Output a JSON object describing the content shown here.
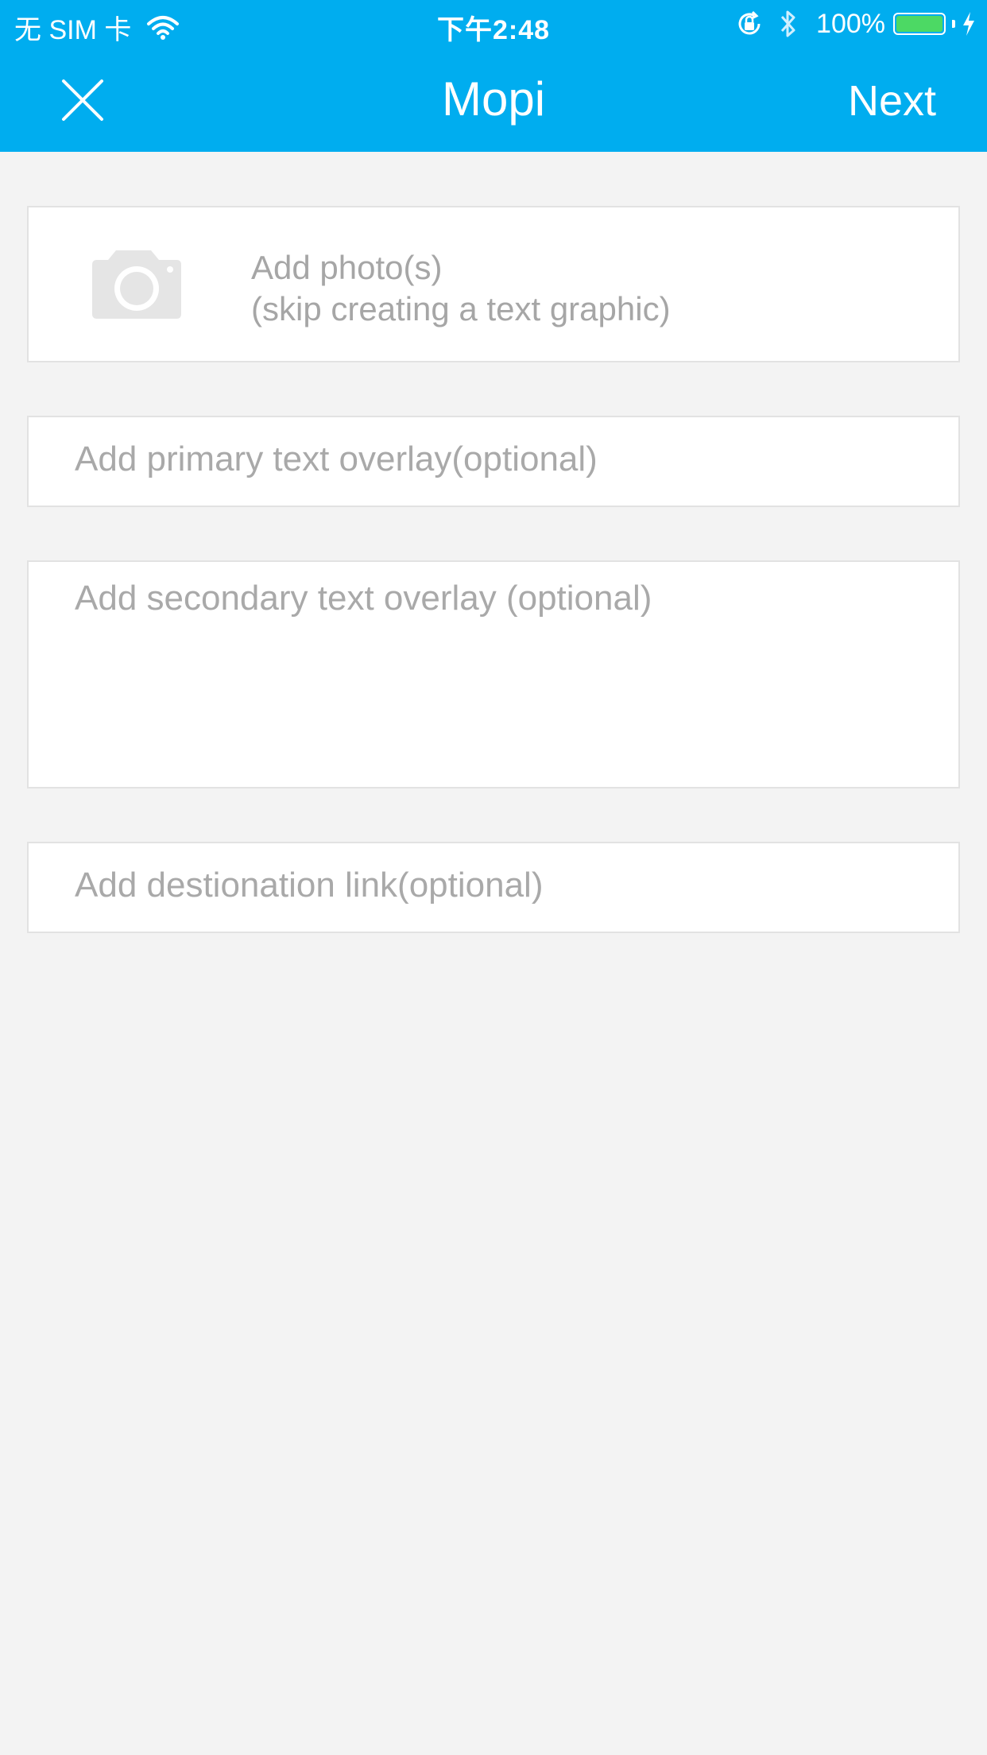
{
  "status_bar": {
    "carrier": "无 SIM 卡",
    "time": "下午2:48",
    "battery_percent": "100%",
    "battery_level": 1.0,
    "battery_color": "#4cd964",
    "icons": [
      "wifi-icon",
      "rotation-lock-icon",
      "bluetooth-icon",
      "battery-icon",
      "charging-icon"
    ]
  },
  "nav": {
    "title": "Mopi",
    "close_icon": "close-icon",
    "next_label": "Next",
    "background": "#00adef"
  },
  "photo_picker": {
    "icon": "camera-icon",
    "line1": "Add photo(s)",
    "line2": "(skip creating a text graphic)"
  },
  "fields": {
    "primary_placeholder": "Add primary text overlay(optional)",
    "secondary_placeholder": "Add secondary text overlay (optional)",
    "link_placeholder": "Add destionation link(optional)"
  }
}
